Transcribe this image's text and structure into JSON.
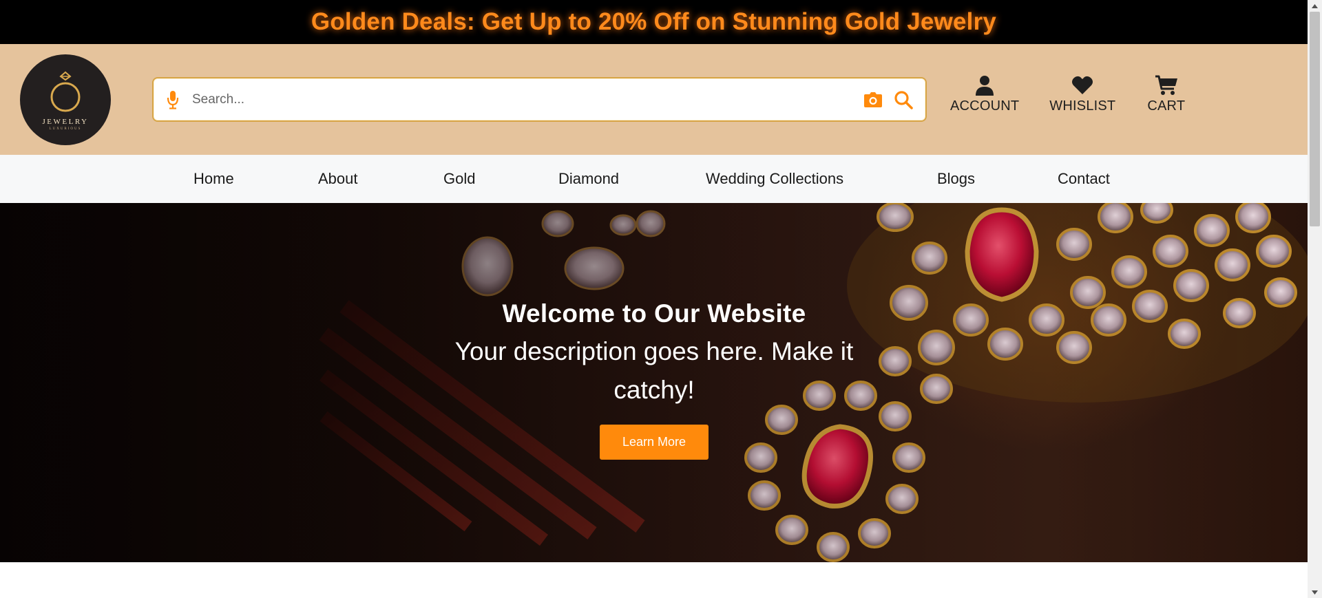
{
  "promo": {
    "text": "Golden Deals: Get Up to 20% Off on Stunning Gold Jewelry"
  },
  "logo": {
    "title": "JEWELRY",
    "subtitle": "LUXURIOUS"
  },
  "search": {
    "placeholder": "Search...",
    "value": ""
  },
  "header_actions": [
    {
      "label": "ACCOUNT",
      "icon": "user-icon"
    },
    {
      "label": "WHISLIST",
      "icon": "heart-icon"
    },
    {
      "label": "CART",
      "icon": "cart-icon"
    }
  ],
  "nav": [
    {
      "label": "Home"
    },
    {
      "label": "About"
    },
    {
      "label": "Gold"
    },
    {
      "label": "Diamond"
    },
    {
      "label": "Wedding Collections"
    },
    {
      "label": "Blogs"
    },
    {
      "label": "Contact"
    }
  ],
  "hero": {
    "title": "Welcome to Our Website",
    "description": "Your description goes here. Make it catchy!",
    "button": "Learn More"
  },
  "colors": {
    "accent": "#ff8a0c",
    "header_bg": "#e5c39c",
    "promo_bg": "#000000",
    "nav_bg": "#f7f8f9"
  }
}
